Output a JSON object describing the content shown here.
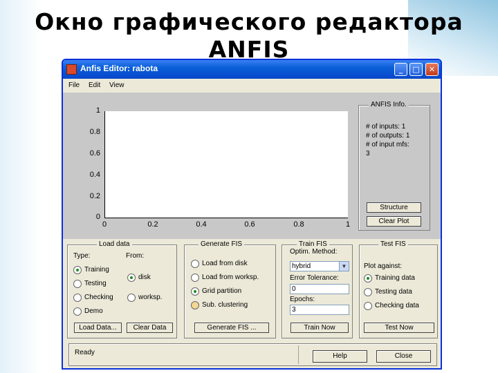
{
  "slide": {
    "title_line1": "Окно графического редактора",
    "title_line2": "ANFIS"
  },
  "window": {
    "title": "Anfis Editor: rabota",
    "controls": {
      "minimize_icon": "minimize-icon",
      "maximize_icon": "maximize-icon",
      "close_icon": "close-icon"
    }
  },
  "menu": {
    "file": "File",
    "edit": "Edit",
    "view": "View"
  },
  "plot": {
    "y_ticks": [
      "1",
      "0.8",
      "0.6",
      "0.4",
      "0.2",
      "0"
    ],
    "x_ticks": [
      "0",
      "0.2",
      "0.4",
      "0.6",
      "0.8",
      "1"
    ]
  },
  "anfis_info": {
    "legend": "ANFIS Info.",
    "lines": [
      "# of inputs: 1",
      "# of outputs: 1",
      "# of input mfs:",
      "3"
    ],
    "structure_button": "Structure",
    "clear_plot_button": "Clear Plot"
  },
  "load_data": {
    "legend": "Load data",
    "type_label": "Type:",
    "from_label": "From:",
    "types": [
      {
        "label": "Training",
        "selected": true
      },
      {
        "label": "Testing",
        "selected": false
      },
      {
        "label": "Checking",
        "selected": false
      },
      {
        "label": "Demo",
        "selected": false
      }
    ],
    "sources": [
      {
        "label": "disk",
        "selected": true
      },
      {
        "label": "worksp.",
        "selected": false
      }
    ],
    "load_button": "Load Data...",
    "clear_button": "Clear Data"
  },
  "generate_fis": {
    "legend": "Generate FIS",
    "options": [
      {
        "label": "Load from disk",
        "selected": false
      },
      {
        "label": "Load from worksp.",
        "selected": false
      },
      {
        "label": "Grid partition",
        "selected": true
      },
      {
        "label": "Sub. clustering",
        "selected": false
      }
    ],
    "generate_button": "Generate FIS ..."
  },
  "train_fis": {
    "legend": "Train FIS",
    "optim_label": "Optim. Method:",
    "optim_value": "hybrid",
    "tolerance_label": "Error Tolerance:",
    "tolerance_value": "0",
    "epochs_label": "Epochs:",
    "epochs_value": "3",
    "train_button": "Train Now"
  },
  "test_fis": {
    "legend": "Test FIS",
    "plot_against_label": "Plot against:",
    "options": [
      {
        "label": "Training data",
        "selected": true
      },
      {
        "label": "Testing data",
        "selected": false
      },
      {
        "label": "Checking data",
        "selected": false
      }
    ],
    "test_button": "Test Now"
  },
  "status": {
    "text": "Ready",
    "help_button": "Help",
    "close_button": "Close"
  }
}
